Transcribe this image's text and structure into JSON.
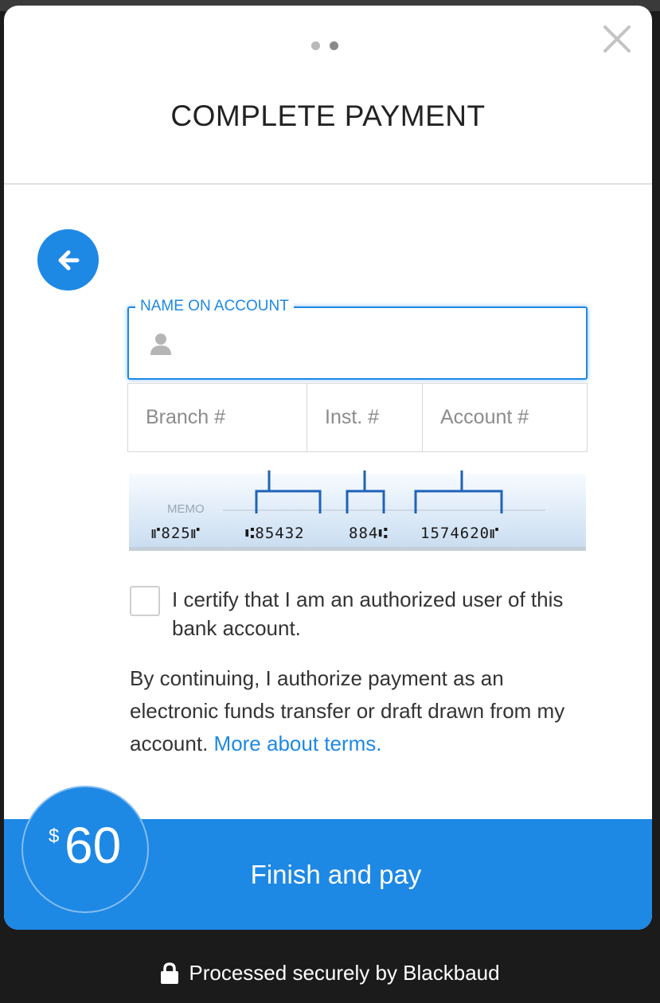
{
  "modal": {
    "title": "COMPLETE PAYMENT",
    "step_indicator": {
      "total_steps": 2,
      "current_step": 2
    },
    "close_icon": "close-icon",
    "back_icon": "arrow-left-icon"
  },
  "form": {
    "name_on_account": {
      "label": "NAME ON ACCOUNT",
      "value": "",
      "icon": "person-icon"
    },
    "branch": {
      "placeholder": "Branch #"
    },
    "institution": {
      "placeholder": "Inst. #"
    },
    "account": {
      "placeholder": "Account #"
    }
  },
  "cheque_illustration": {
    "memo_label": "MEMO",
    "cheque_number": "⑈825⑈",
    "branch_digits": "⑆85432",
    "institution_digits": "884⑆",
    "account_digits": "1574620⑈"
  },
  "certify": {
    "checked": false,
    "text": "I certify that I am an authorized user of this bank account."
  },
  "terms": {
    "text": "By continuing, I authorize payment as an electronic funds transfer or draft drawn from my account.",
    "link_text": "More about terms."
  },
  "payment": {
    "currency_symbol": "$",
    "amount": "60",
    "button_label": "Finish and pay"
  },
  "footer": {
    "text": "Processed securely by Blackbaud",
    "icon": "lock-icon"
  },
  "colors": {
    "accent": "#1e88e5",
    "backdrop": "#1b1b1b"
  }
}
